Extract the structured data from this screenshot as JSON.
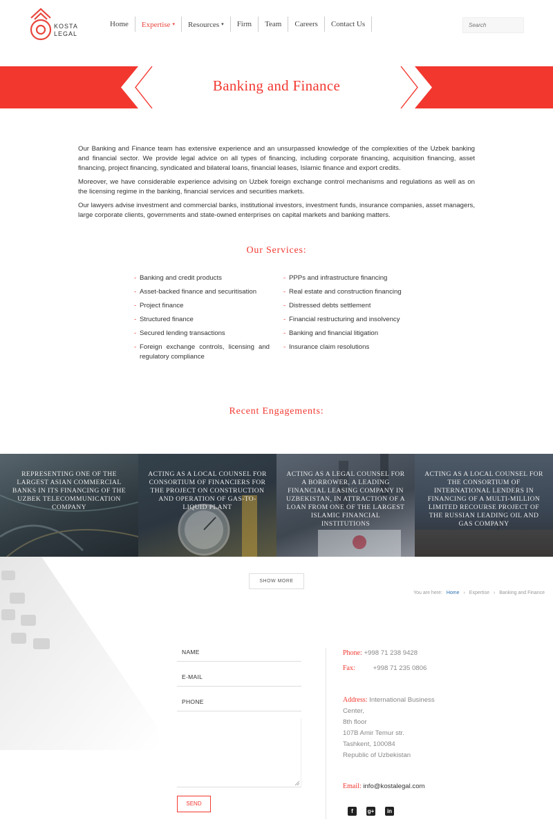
{
  "logo": {
    "line1": "KOSTA",
    "line2": "LEGAL"
  },
  "nav": {
    "items": [
      {
        "label": "Home"
      },
      {
        "label": "Expertise",
        "caret": "▾"
      },
      {
        "label": "Resources",
        "caret": "▾"
      },
      {
        "label": "Firm"
      },
      {
        "label": "Team"
      },
      {
        "label": "Careers"
      },
      {
        "label": "Contact Us"
      }
    ]
  },
  "search": {
    "placeholder": "Search"
  },
  "banner": {
    "title": "Banking and Finance"
  },
  "intro": {
    "p1": "Our Banking and Finance team has extensive experience and an unsurpassed knowledge of the complexities of the Uzbek banking and financial sector. We provide legal advice on all types of financing, including corporate financing, acquisition financing, asset financing, project financing, syndicated and bilateral loans, financial leases, Islamic finance and export credits.",
    "p2": "Moreover, we have considerable experience advising on Uzbek foreign exchange control mechanisms and regulations as well as on the licensing regime in the banking, financial services and securities markets.",
    "p3": "Our lawyers advise investment and commercial banks, institutional investors, investment funds, insurance companies, asset managers, large corporate clients, governments and state-owned enterprises on capital markets and banking matters."
  },
  "services": {
    "title": "Our Services:",
    "left": [
      "Banking and credit products",
      "Asset-backed finance and securitisation",
      "Project finance",
      "Structured finance",
      "Secured lending transactions",
      "Foreign exchange controls, licensing and regulatory compliance"
    ],
    "right": [
      "PPPs and infrastructure financing",
      "Real estate and construction financing",
      "Distressed debts settlement",
      "Financial restructuring and insolvency",
      "Banking and financial litigation",
      "Insurance claim resolutions"
    ]
  },
  "engagements": {
    "title": "Recent Engagements:",
    "items": [
      "Representing one of the largest Asian commercial banks in its financing of the Uzbek telecommunication company",
      "Acting as a local counsel for consortium of financiers for the project on construction and operation of gas-to-liquid plant",
      "Acting as a legal counsel for a borrower, a leading financial leasing company in Uzbekistan, in attraction of a loan from one of the largest Islamic financial institutions",
      "Acting as a local counsel for the consortium of international lenders in financing of a multi-million limited recourse project of the Russian leading oil and gas company"
    ],
    "colors": [
      "#3b4a52",
      "#3a4650",
      "#4a5360",
      "#3b4b5a"
    ],
    "show_more": "SHOW MORE"
  },
  "breadcrumb": {
    "prefix": "You are here:",
    "home": "Home",
    "sep": "›",
    "expertise": "Expertise",
    "current": "Banking and Finance"
  },
  "form": {
    "name": "NAME",
    "email": "E-MAIL",
    "phone": "PHONE",
    "send": "SEND"
  },
  "contact": {
    "phone_label": "Phone:",
    "phone_value": "+998 71 238 9428",
    "fax_label": "Fax:",
    "fax_value": "+998 71 235 0806",
    "address_label": "Address:",
    "address_lines": [
      "International Business",
      "Center,",
      "8th floor",
      "107B Amir Temur str.",
      "Tashkent, 100084",
      "Republic of Uzbekistan"
    ],
    "email_label": "Email:",
    "email_value": "info@kostalegal.com"
  },
  "social": [
    "facebook-icon",
    "google-plus-icon",
    "linkedin-icon"
  ],
  "colors": {
    "accent": "#f2372f"
  }
}
